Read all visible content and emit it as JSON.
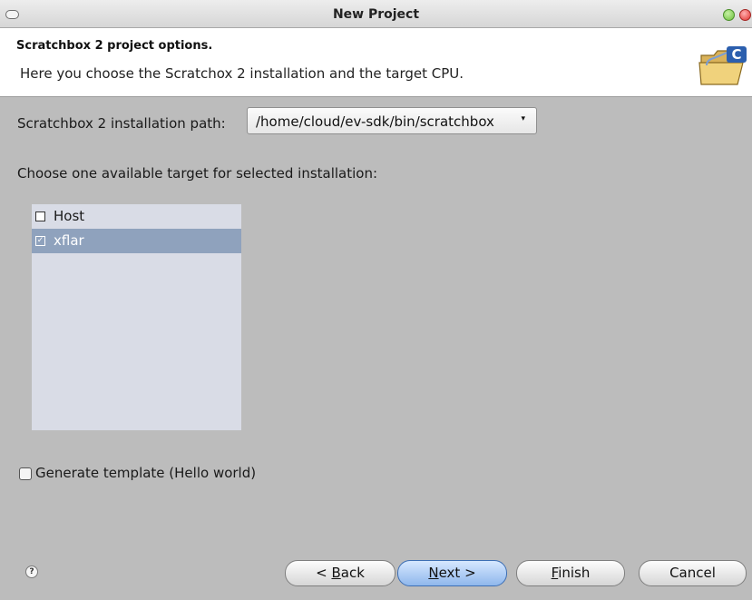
{
  "window": {
    "title": "New Project"
  },
  "header": {
    "title": "Scratchbox 2 project options.",
    "description": "Here you choose the Scratchox 2 installation and the target CPU."
  },
  "installation": {
    "label": "Scratchbox 2 installation path:",
    "selected_value": "/home/cloud/ev-sdk/bin/scratchbox",
    "arrow": "▾"
  },
  "targets": {
    "label": "Choose one available target for selected installation:",
    "items": [
      {
        "label": "Host",
        "checked": false
      },
      {
        "label": "xflar",
        "checked": true
      }
    ]
  },
  "template_option": {
    "label": "Generate template (Hello world)",
    "checked": false
  },
  "buttons": {
    "help": "?",
    "back_prefix": "< ",
    "back_mnemonic": "B",
    "back_rest": "ack",
    "next_mnemonic": "N",
    "next_rest": "ext >",
    "finish_mnemonic": "F",
    "finish_rest": "inish",
    "cancel": "Cancel"
  },
  "colors": {
    "dialog_bg": "#bcbcbc",
    "list_bg": "#d9dce6",
    "selection": "#8fa2bd",
    "default_button": "#8fb7ec"
  },
  "icons": {
    "header": "new-c-project-folder-icon"
  }
}
